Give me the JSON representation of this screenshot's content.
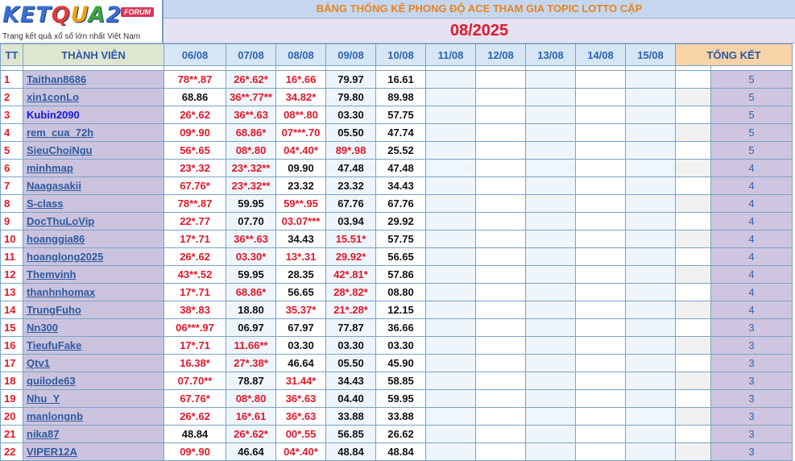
{
  "logo": {
    "word_1": "KET",
    "word_2": "Q",
    "word_3": "U",
    "word_4": "A",
    "word_5": "2",
    "badge": "FORUM",
    "tagline": "Trang kết quả xổ số lớn nhất Việt Nam"
  },
  "title": "BẢNG THỐNG KÊ PHONG ĐỘ ACE THAM GIA TOPIC  LOTTO CẶP",
  "month": "08/2025",
  "headers": {
    "tt": "TT",
    "member": "THÀNH VIÊN",
    "dates": [
      "06/08",
      "07/08",
      "08/08",
      "09/08",
      "10/08",
      "11/08",
      "12/08",
      "13/08",
      "14/08",
      "15/08"
    ],
    "summary": "TỔNG KẾT"
  },
  "rows": [
    {
      "tt": "1",
      "name": "Taithan8686",
      "top": false,
      "values": [
        "78**.87",
        "26*.62*",
        "16*.66",
        "79.97",
        "16.61"
      ],
      "hits": [
        true,
        true,
        true,
        false,
        false
      ],
      "total": "5"
    },
    {
      "tt": "2",
      "name": "xin1conLo",
      "top": false,
      "values": [
        "68.86",
        "36**.77**",
        "34.82*",
        "79.80",
        "89.98"
      ],
      "hits": [
        false,
        true,
        true,
        false,
        false
      ],
      "total": "5"
    },
    {
      "tt": "3",
      "name": "Kubin2090",
      "top": true,
      "values": [
        "26*.62",
        "36**.63",
        "08**.80",
        "03.30",
        "57.75"
      ],
      "hits": [
        true,
        true,
        true,
        false,
        false
      ],
      "total": "5"
    },
    {
      "tt": "4",
      "name": "rem_cua_72h",
      "top": false,
      "values": [
        "09*.90",
        "68.86*",
        "07***.70",
        "05.50",
        "47.74"
      ],
      "hits": [
        true,
        true,
        true,
        false,
        false
      ],
      "total": "5"
    },
    {
      "tt": "5",
      "name": "SieuChoiNgu",
      "top": false,
      "values": [
        "56*.65",
        "08*.80",
        "04*.40*",
        "89*.98",
        "25.52"
      ],
      "hits": [
        true,
        true,
        true,
        true,
        false
      ],
      "total": "5"
    },
    {
      "tt": "6",
      "name": "minhmap",
      "top": false,
      "values": [
        "23*.32",
        "23*.32**",
        "09.90",
        "47.48",
        "47.48"
      ],
      "hits": [
        true,
        true,
        false,
        false,
        false
      ],
      "total": "4"
    },
    {
      "tt": "7",
      "name": "Naagasakii",
      "top": false,
      "values": [
        "67.76*",
        "23*.32**",
        "23.32",
        "23.32",
        "34.43"
      ],
      "hits": [
        true,
        true,
        false,
        false,
        false
      ],
      "total": "4"
    },
    {
      "tt": "8",
      "name": "S-class",
      "top": false,
      "values": [
        "78**.87",
        "59.95",
        "59**.95",
        "67.76",
        "67.76"
      ],
      "hits": [
        true,
        false,
        true,
        false,
        false
      ],
      "total": "4"
    },
    {
      "tt": "9",
      "name": "DocThuLoVip",
      "top": false,
      "values": [
        "22*.77",
        "07.70",
        "03.07***",
        "03.94",
        "29.92"
      ],
      "hits": [
        true,
        false,
        true,
        false,
        false
      ],
      "total": "4"
    },
    {
      "tt": "10",
      "name": "hoanggia86",
      "top": false,
      "values": [
        "17*.71",
        "36**.63",
        "34.43",
        "15.51*",
        "57.75"
      ],
      "hits": [
        true,
        true,
        false,
        true,
        false
      ],
      "total": "4"
    },
    {
      "tt": "11",
      "name": "hoanglong2025",
      "top": false,
      "values": [
        "26*.62",
        "03.30*",
        "13*.31",
        "29.92*",
        "56.65"
      ],
      "hits": [
        true,
        true,
        true,
        true,
        false
      ],
      "total": "4"
    },
    {
      "tt": "12",
      "name": "Themvinh",
      "top": false,
      "values": [
        "43**.52",
        "59.95",
        "28.35",
        "42*.81*",
        "57.86"
      ],
      "hits": [
        true,
        false,
        false,
        true,
        false
      ],
      "total": "4"
    },
    {
      "tt": "13",
      "name": "thanhnhomax",
      "top": false,
      "values": [
        "17*.71",
        "68.86*",
        "56.65",
        "28*.82*",
        "08.80"
      ],
      "hits": [
        true,
        true,
        false,
        true,
        false
      ],
      "total": "4"
    },
    {
      "tt": "14",
      "name": "TrungFuho",
      "top": false,
      "values": [
        "38*.83",
        "18.80",
        "35.37*",
        "21*.28*",
        "12.15"
      ],
      "hits": [
        true,
        false,
        true,
        true,
        false
      ],
      "total": "4"
    },
    {
      "tt": "15",
      "name": "Nn300",
      "top": false,
      "values": [
        "06***.97",
        "06.97",
        "67.97",
        "77.87",
        "36.66"
      ],
      "hits": [
        true,
        false,
        false,
        false,
        false
      ],
      "total": "3"
    },
    {
      "tt": "16",
      "name": "TieufuFake",
      "top": false,
      "values": [
        "17*.71",
        "11.66**",
        "03.30",
        "03.30",
        "03.30"
      ],
      "hits": [
        true,
        true,
        false,
        false,
        false
      ],
      "total": "3"
    },
    {
      "tt": "17",
      "name": "Qtv1",
      "top": false,
      "values": [
        "16.38*",
        "27*.38*",
        "46.64",
        "05.50",
        "45.90"
      ],
      "hits": [
        true,
        true,
        false,
        false,
        false
      ],
      "total": "3"
    },
    {
      "tt": "18",
      "name": "quilode63",
      "top": false,
      "values": [
        "07.70**",
        "78.87",
        "31.44*",
        "34.43",
        "58.85"
      ],
      "hits": [
        true,
        false,
        true,
        false,
        false
      ],
      "total": "3"
    },
    {
      "tt": "19",
      "name": "Nhu_Y",
      "top": false,
      "values": [
        "67.76*",
        "08*.80",
        "36*.63",
        "04.40",
        "59.95"
      ],
      "hits": [
        true,
        true,
        true,
        false,
        false
      ],
      "total": "3"
    },
    {
      "tt": "20",
      "name": "manlongnb",
      "top": false,
      "values": [
        "26*.62",
        "16*.61",
        "36*.63",
        "33.88",
        "33.88"
      ],
      "hits": [
        true,
        true,
        true,
        false,
        false
      ],
      "total": "3"
    },
    {
      "tt": "21",
      "name": "nika87",
      "top": false,
      "values": [
        "48.84",
        "26*.62*",
        "00*.55",
        "56.85",
        "26.62"
      ],
      "hits": [
        false,
        true,
        true,
        false,
        false
      ],
      "total": "3"
    },
    {
      "tt": "22",
      "name": "VIPER12A",
      "top": false,
      "values": [
        "09*.90",
        "46.64",
        "04*.40*",
        "48.84",
        "48.84"
      ],
      "hits": [
        true,
        false,
        true,
        false,
        false
      ],
      "total": "3"
    }
  ],
  "colors": {
    "hit": "#e0182a",
    "miss": "#111111",
    "member": "#2e5aa0",
    "title": "#e8831b",
    "month": "#e0182a"
  }
}
